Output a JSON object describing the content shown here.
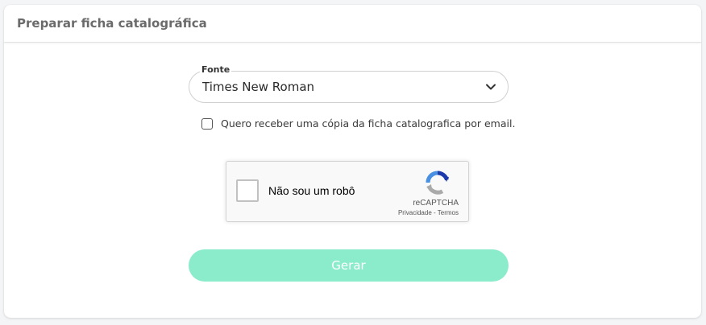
{
  "card": {
    "title": "Preparar ficha catalográfica"
  },
  "font_select": {
    "label": "Fonte",
    "value": "Times New Roman"
  },
  "email_option": {
    "label": "Quero receber uma cópia da ficha catalografica por email.",
    "checked": false
  },
  "recaptcha": {
    "label": "Não sou um robô",
    "brand": "reCAPTCHA",
    "privacy_link": "Privacidade",
    "separator": "-",
    "terms_link": "Termos"
  },
  "submit": {
    "label": "Gerar"
  },
  "colors": {
    "submit_bg": "#8aecca",
    "title_text": "#6b6b6b"
  }
}
